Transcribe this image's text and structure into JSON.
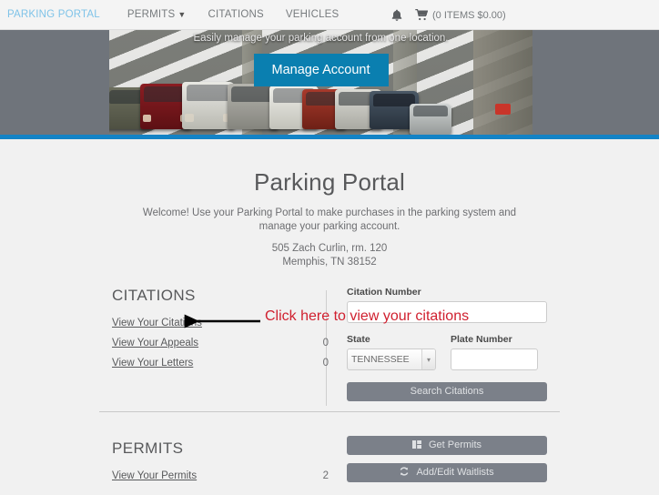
{
  "navbar": {
    "brand": "PARKING PORTAL",
    "items": [
      {
        "label": "PERMITS",
        "has_caret": true
      },
      {
        "label": "CITATIONS",
        "has_caret": false
      },
      {
        "label": "VEHICLES",
        "has_caret": false
      }
    ],
    "bell_icon": "bell-icon",
    "cart_icon": "shopping-cart-icon",
    "cart_text": "(0 ITEMS $0.00)"
  },
  "hero": {
    "caption": "Easily manage your parking account from one location.",
    "button_label": "Manage Account",
    "button_color": "#0a7fb0",
    "underline_color": "#1383c6",
    "side_color": "#6f747b"
  },
  "page": {
    "title": "Parking Portal",
    "welcome_line_1": "Welcome! Use your Parking Portal to make purchases in the parking system and",
    "welcome_line_2": "manage your parking account.",
    "address_line_1": "505 Zach Curlin, rm. 120",
    "address_line_2": "Memphis, TN 38152"
  },
  "citations": {
    "heading": "CITATIONS",
    "links": [
      {
        "label": "View Your Citations",
        "count": ""
      },
      {
        "label": "View Your Appeals",
        "count": "0"
      },
      {
        "label": "View Your Letters",
        "count": "0"
      }
    ],
    "citation_number_label": "Citation Number",
    "citation_number_value": "",
    "state_label": "State",
    "state_value": "TENNESSEE",
    "plate_label": "Plate Number",
    "plate_value": "",
    "search_button": "Search Citations"
  },
  "permits": {
    "heading": "PERMITS",
    "links": [
      {
        "label": "View Your Permits",
        "count": "2"
      }
    ],
    "get_permits_button": "Get Permits",
    "get_permits_icon": "grid-icon",
    "waitlists_button": "Add/Edit Waitlists",
    "waitlists_icon": "refresh-icon"
  },
  "annotation": {
    "text": "Click here to view your citations",
    "color": "#d0202f",
    "arrow_color": "#000000"
  }
}
